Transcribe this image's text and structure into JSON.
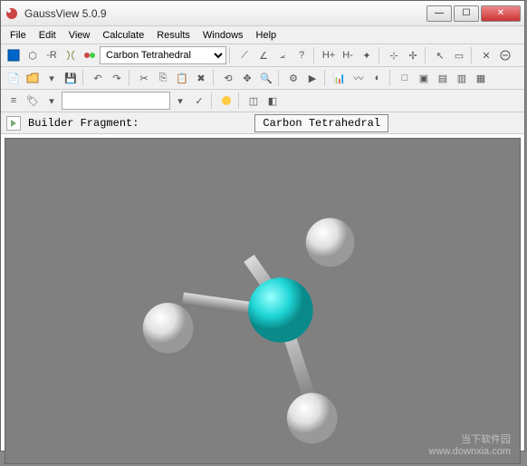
{
  "titlebar": {
    "title": "GaussView 5.0.9"
  },
  "menu": {
    "file": "File",
    "edit": "Edit",
    "view": "View",
    "calculate": "Calculate",
    "results": "Results",
    "windows": "Windows",
    "help": "Help"
  },
  "toolbar1": {
    "element_combo": "Carbon Tetrahedral"
  },
  "toolbar3": {
    "text_input": ""
  },
  "fragment_bar": {
    "label": "Builder Fragment:",
    "value": "Carbon Tetrahedral"
  },
  "watermark": {
    "line1": "当下软件园",
    "line2": "www.downxia.com"
  },
  "molecule": {
    "center_color": "#1fd5d5",
    "atom_color": "#e8e8e8",
    "bond_color": "#b8b8b8"
  }
}
